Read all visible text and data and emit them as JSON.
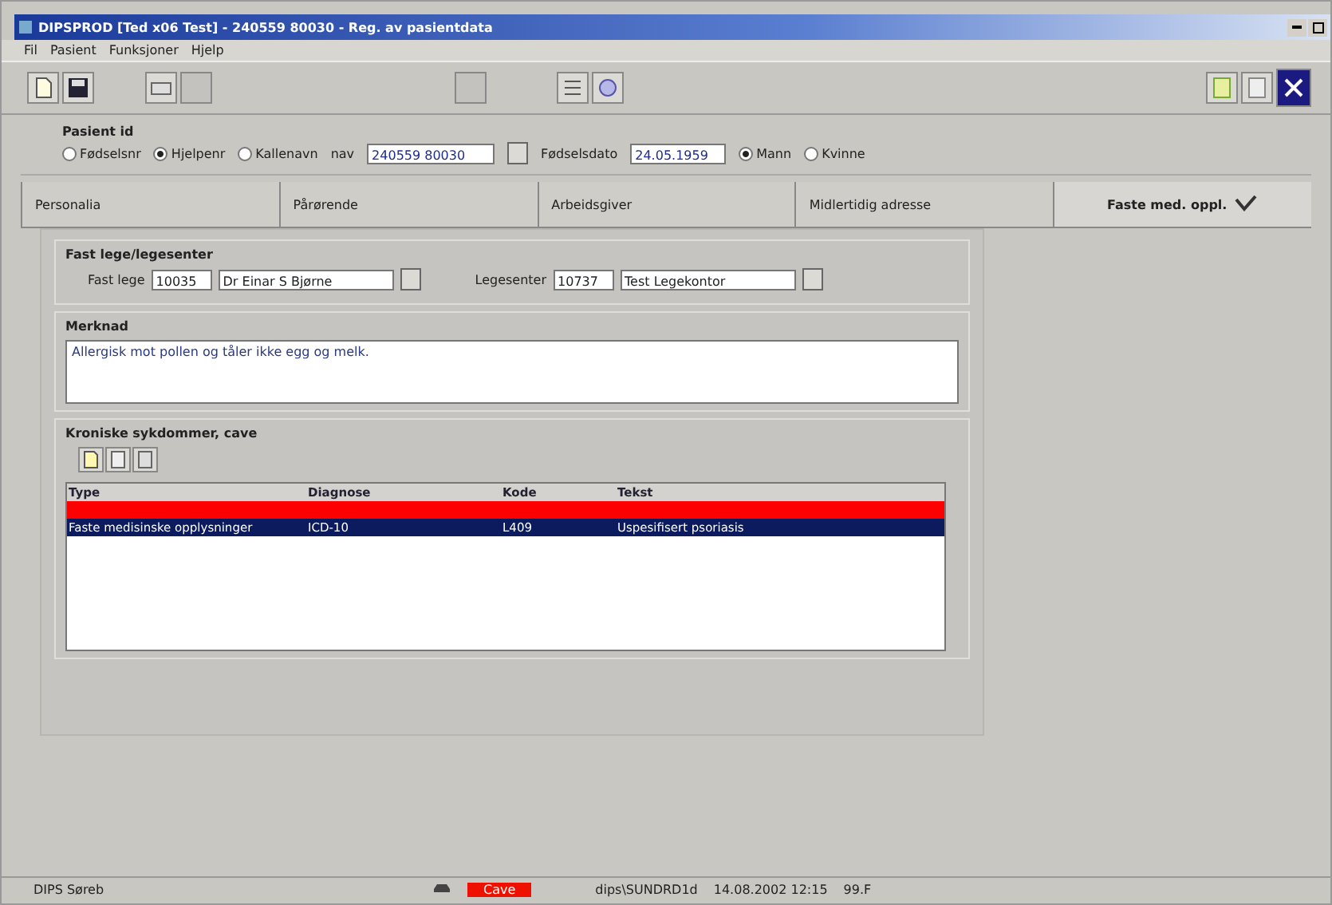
{
  "window": {
    "title": "DIPSPROD [Ted x06 Test] - 240559 80030 - Reg. av pasientdata"
  },
  "menu": [
    "Fil",
    "Pasient",
    "Funksjoner",
    "Hjelp"
  ],
  "patient_id": {
    "title": "Pasient id",
    "options": [
      {
        "label": "Fødselsnr",
        "selected": false
      },
      {
        "label": "Hjelpenr",
        "selected": true
      },
      {
        "label": "Kallenavn",
        "selected": false
      }
    ],
    "id_label": "nav",
    "id_value": "240559 80030",
    "birth_label": "Fødselsdato",
    "birth_value": "24.05.1959",
    "sex": [
      {
        "label": "Mann",
        "selected": true
      },
      {
        "label": "Kvinne",
        "selected": false
      }
    ]
  },
  "tabs": [
    {
      "label": "Personalia",
      "selected": false
    },
    {
      "label": "Pårørende",
      "selected": false
    },
    {
      "label": "Arbeidsgiver",
      "selected": false
    },
    {
      "label": "Midlertidig adresse",
      "selected": false
    },
    {
      "label": "Faste med. oppl.",
      "selected": true
    }
  ],
  "gp": {
    "title": "Fast lege/legesenter",
    "doctor_label": "Fast lege",
    "doctor_id": "10035",
    "doctor_name": "Dr Einar S Bjørne",
    "center_label": "Legesenter",
    "center_id": "10737",
    "center_name": "Test Legekontor"
  },
  "note": {
    "title": "Merknad",
    "text": "Allergisk mot pollen og tåler ikke egg og melk."
  },
  "chronic": {
    "title": "Kroniske sykdommer, cave",
    "columns": [
      "Type",
      "Diagnose",
      "Kode",
      "Tekst"
    ],
    "rows": [
      {
        "color": "#ff0000",
        "cells": []
      },
      {
        "color": "#0c1a5e",
        "cells": [
          "Faste medisinske opplysninger",
          "ICD-10",
          "L409",
          "Uspesifisert psoriasis"
        ]
      }
    ]
  },
  "status_bar": [
    "DIPS Søreb",
    "Cave",
    "dips\\SUNDRD1d",
    "14.08.2002 12:15",
    "99.F"
  ]
}
